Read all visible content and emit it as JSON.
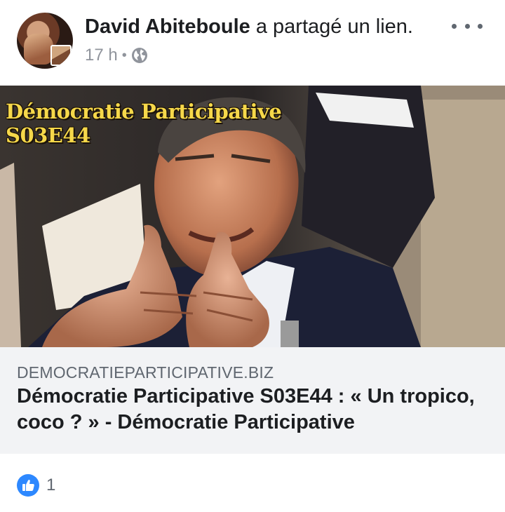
{
  "post": {
    "author": {
      "name": "David Abiteboule",
      "action": "a partagé un lien."
    },
    "time": "17 h",
    "separator": "•",
    "privacy_icon": "globe-icon",
    "menu_icon": "more-options-icon"
  },
  "link": {
    "image_title_line1": "Démocratie Participative",
    "image_title_line2": "S03E44",
    "domain": "DEMOCRATIEPARTICIPATIVE.BIZ",
    "title": "Démocratie Participative S03E44 : « Un tropico, coco ? » - Démocratie Participative"
  },
  "reactions": {
    "icon": "like-icon",
    "count": "1"
  },
  "colors": {
    "overlay_text": "#f6d84a",
    "caption_bg": "#f2f3f5",
    "like_blue": "#2d88ff",
    "meta_gray": "#90949c"
  }
}
